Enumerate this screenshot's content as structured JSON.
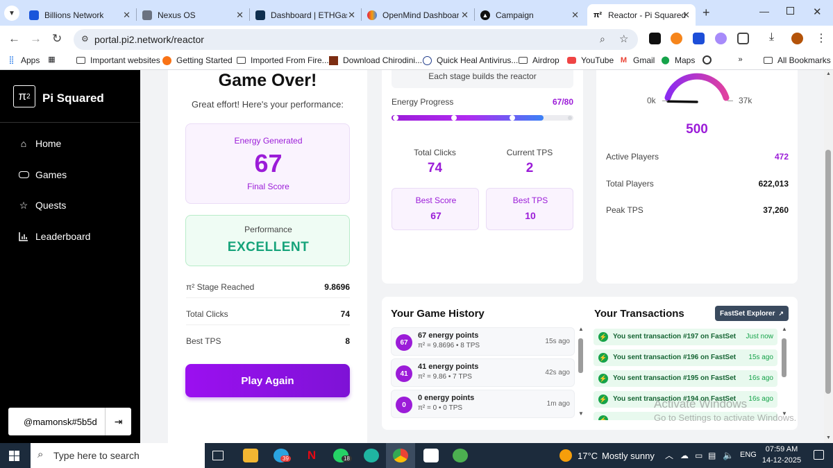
{
  "browser": {
    "tabs": [
      {
        "title": "Billions Network",
        "favicon_color": "#1a56db"
      },
      {
        "title": "Nexus OS",
        "favicon_color": "#6b7280"
      },
      {
        "title": "Dashboard | ETHGas",
        "favicon_color": "#0f2f4f"
      },
      {
        "title": "OpenMind Dashboar",
        "favicon_color": "#e11d48"
      },
      {
        "title": "Campaign",
        "favicon_color": "#111111"
      },
      {
        "title": "Reactor - Pi Squared",
        "favicon_color": "#000000"
      }
    ],
    "active_tab": 5,
    "url": "portal.pi2.network/reactor",
    "bookmarks": [
      {
        "label": "Apps"
      },
      {
        "label": "Important websites"
      },
      {
        "label": "Getting Started"
      },
      {
        "label": "Imported From Fire..."
      },
      {
        "label": "Download Chirodini..."
      },
      {
        "label": "Quick Heal Antivirus..."
      },
      {
        "label": "Airdrop"
      },
      {
        "label": "YouTube"
      },
      {
        "label": "Gmail"
      },
      {
        "label": "Maps"
      }
    ],
    "all_bookmarks": "All Bookmarks"
  },
  "sidebar": {
    "logo_text": "π",
    "logo_sup": "2",
    "brand": "Pi Squared",
    "items": [
      {
        "label": "Home"
      },
      {
        "label": "Games"
      },
      {
        "label": "Quests"
      },
      {
        "label": "Leaderboard"
      }
    ],
    "username": "@mamonsk#5b5d"
  },
  "game_over": {
    "title": "Game Over!",
    "subtitle": "Great effort! Here's your performance:",
    "energy_label": "Energy Generated",
    "energy_value": "67",
    "energy_caption": "Final Score",
    "performance_label": "Performance",
    "performance_value": "EXCELLENT",
    "stats": [
      {
        "label": "π² Stage Reached",
        "value": "9.8696"
      },
      {
        "label": "Total Clicks",
        "value": "74"
      },
      {
        "label": "Best TPS",
        "value": "8"
      }
    ],
    "play_again": "Play Again"
  },
  "progress": {
    "stage_note": "Each stage builds the reactor",
    "energy_label": "Energy Progress",
    "energy_value": "67/80",
    "fraction": 0.8375,
    "total_clicks_label": "Total Clicks",
    "total_clicks": "74",
    "current_tps_label": "Current TPS",
    "current_tps": "2",
    "best_score_label": "Best Score",
    "best_score": "67",
    "best_tps_label": "Best TPS",
    "best_tps": "10"
  },
  "network": {
    "gauge_min": "0k",
    "gauge_max": "37k",
    "gauge_value": "500",
    "gauge_fraction": 0.02,
    "active_players_label": "Active Players",
    "active_players": "472",
    "total_players_label": "Total Players",
    "total_players": "622,013",
    "peak_tps_label": "Peak TPS",
    "peak_tps": "37,260"
  },
  "history": {
    "title": "Your Game History",
    "items": [
      {
        "badge": "67",
        "title": "67 energy points",
        "detail": "π² = 9.8696 • 8 TPS",
        "ago": "15s ago"
      },
      {
        "badge": "41",
        "title": "41 energy points",
        "detail": "π² = 9.86 • 7 TPS",
        "ago": "42s ago"
      },
      {
        "badge": "0",
        "title": "0 energy points",
        "detail": "π² = 0 • 0 TPS",
        "ago": "1m ago"
      }
    ]
  },
  "transactions": {
    "title": "Your Transactions",
    "explorer_button": "FastSet Explorer",
    "items": [
      {
        "text": "You sent transaction #197 on FastSet",
        "ago": "Just now"
      },
      {
        "text": "You sent transaction #196 on FastSet",
        "ago": "15s ago"
      },
      {
        "text": "You sent transaction #195 on FastSet",
        "ago": "16s ago"
      },
      {
        "text": "You sent transaction #194 on FastSet",
        "ago": "16s ago"
      }
    ]
  },
  "watermark": {
    "line1": "Activate Windows",
    "line2": "Go to Settings to activate Windows."
  },
  "taskbar": {
    "search_placeholder": "Type here to search",
    "badge_telegram": "39",
    "badge_whatsapp": "18",
    "weather_temp": "17°C",
    "weather_text": "Mostly sunny",
    "language": "ENG",
    "time": "07:59 AM",
    "date": "14-12-2025"
  },
  "colors": {
    "accent_purple": "#9b1cd8",
    "accent_green": "#16a34a",
    "sidebar_bg": "#000000",
    "tab_bar": "#d3e3fd"
  }
}
